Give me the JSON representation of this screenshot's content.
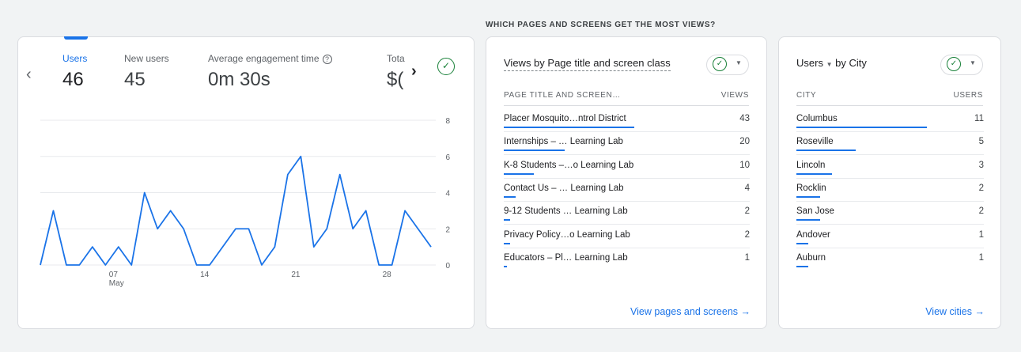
{
  "heading": "WHICH PAGES AND SCREENS GET THE MOST VIEWS?",
  "metrics": [
    {
      "label": "Users",
      "value": "46"
    },
    {
      "label": "New users",
      "value": "45"
    },
    {
      "label": "Average engagement time",
      "value": "0m 30s"
    },
    {
      "label": "Tota",
      "value": "$("
    }
  ],
  "icons": {
    "help": "?",
    "check": "✓",
    "prev": "‹",
    "next": "›",
    "dropdown": "▼",
    "arrow_right": "→"
  },
  "colors": {
    "accent": "#1a73e8",
    "success": "#188038"
  },
  "chart_data": {
    "type": "line",
    "x": [
      1,
      2,
      3,
      4,
      5,
      6,
      7,
      8,
      9,
      10,
      11,
      12,
      13,
      14,
      15,
      16,
      17,
      18,
      19,
      20,
      21,
      22,
      23,
      24,
      25,
      26,
      27,
      28,
      29,
      30,
      31
    ],
    "values": [
      0,
      3,
      0,
      0,
      1,
      0,
      1,
      0,
      4,
      2,
      3,
      2,
      0,
      0,
      1,
      2,
      2,
      0,
      1,
      5,
      6,
      1,
      2,
      5,
      2,
      3,
      0,
      0,
      3,
      2,
      1
    ],
    "x_tick_labels": [
      {
        "day": 7,
        "label": "07",
        "sublabel": "May"
      },
      {
        "day": 14,
        "label": "14"
      },
      {
        "day": 21,
        "label": "21"
      },
      {
        "day": 28,
        "label": "28"
      }
    ],
    "y_tick_labels": [
      "0",
      "2",
      "4",
      "6",
      "8"
    ],
    "ylim": [
      0,
      8
    ],
    "grid": true
  },
  "pages_card": {
    "title": "Views by Page title and screen class",
    "col_label": "PAGE TITLE AND SCREEN…",
    "col_value": "VIEWS",
    "rows": [
      {
        "label": "Placer Mosquito…ntrol District",
        "value": "43"
      },
      {
        "label": "Internships – … Learning Lab",
        "value": "20"
      },
      {
        "label": "K-8 Students –…o Learning Lab",
        "value": "10"
      },
      {
        "label": "Contact Us – … Learning Lab",
        "value": "4"
      },
      {
        "label": "9-12 Students … Learning Lab",
        "value": "2"
      },
      {
        "label": "Privacy Policy…o Learning Lab",
        "value": "2"
      },
      {
        "label": "Educators – Pl… Learning Lab",
        "value": "1"
      }
    ],
    "footer": "View pages and screens"
  },
  "cities_card": {
    "metric": "Users",
    "by_label": "by City",
    "col_label": "CITY",
    "col_value": "USERS",
    "rows": [
      {
        "label": "Columbus",
        "value": "11"
      },
      {
        "label": "Roseville",
        "value": "5"
      },
      {
        "label": "Lincoln",
        "value": "3"
      },
      {
        "label": "Rocklin",
        "value": "2"
      },
      {
        "label": "San Jose",
        "value": "2"
      },
      {
        "label": "Andover",
        "value": "1"
      },
      {
        "label": "Auburn",
        "value": "1"
      }
    ],
    "footer": "View cities"
  }
}
